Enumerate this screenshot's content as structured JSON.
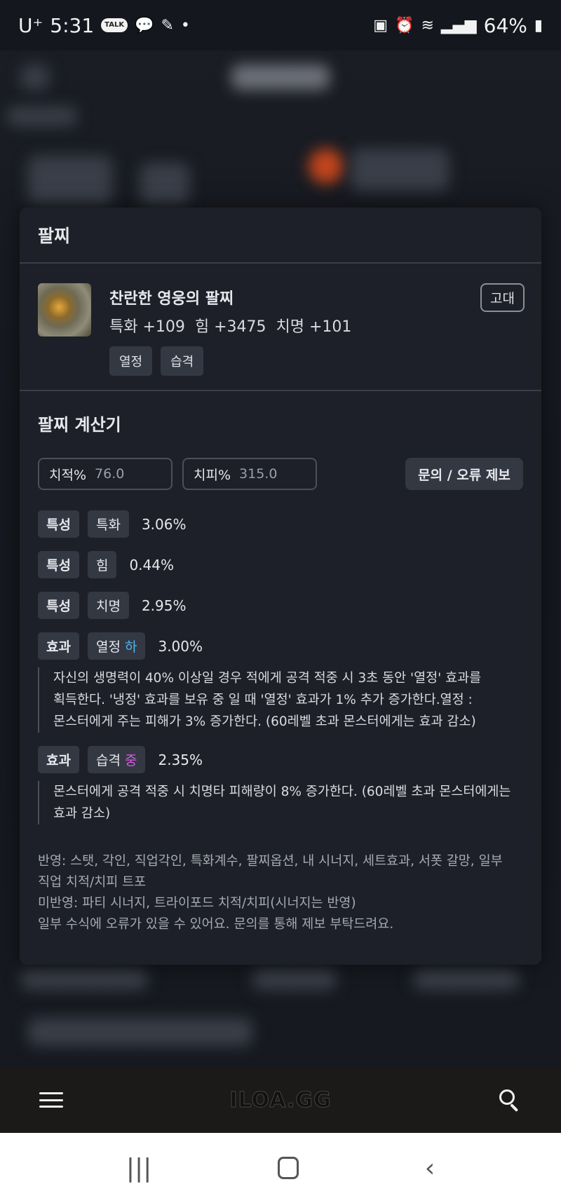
{
  "status_bar": {
    "carrier": "U⁺",
    "time": "5:31",
    "battery": "64%"
  },
  "modal": {
    "header": "팔찌",
    "item": {
      "name": "찬란한 영웅의 팔찌",
      "stats": "특화 +109  힘 +3475  치명 +101",
      "tags": [
        "열정",
        "습격"
      ],
      "grade": "고대"
    },
    "calculator": {
      "title": "팔찌 계산기",
      "crit_rate": {
        "label": "치적%",
        "value": "76.0"
      },
      "crit_dmg": {
        "label": "치피%",
        "value": "315.0"
      },
      "report_button": "문의 / 오류 제보",
      "rows": [
        {
          "kind": "특성",
          "name": "특화",
          "value": "3.06%"
        },
        {
          "kind": "특성",
          "name": "힘",
          "value": "0.44%"
        },
        {
          "kind": "특성",
          "name": "치명",
          "value": "2.95%"
        }
      ],
      "effects": [
        {
          "kind": "효과",
          "name": "열정",
          "level": "하",
          "value": "3.00%",
          "desc": [
            "자신의 생명력이 40% 이상일 경우 적에게 공격 적중 시 3초 동안 '열정' 효과를",
            "획득한다. '냉정' 효과를 보유 중 일 때 '열정' 효과가 1% 추가 증가한다.열정 :",
            "몬스터에게 주는 피해가 3% 증가한다. (60레벨 초과 몬스터에게는 효과 감소)"
          ]
        },
        {
          "kind": "효과",
          "name": "습격",
          "level": "중",
          "value": "2.35%",
          "desc": [
            "몬스터에게 공격 적중 시 치명타 피해량이 8% 증가한다. (60레벨 초과 몬스터에게는",
            "효과 감소)"
          ]
        }
      ],
      "notes": [
        "반영: 스탯, 각인, 직업각인, 특화계수, 팔찌옵션, 내 시너지, 세트효과, 서폿 갈망, 일부",
        "직업 치적/치피 트포",
        "미반영: 파티 시너지, 트라이포드 치적/치피(시너지는 반영)",
        "일부 수식에 오류가 있을 수 있어요. 문의를 통해 제보 부탁드려요."
      ]
    }
  },
  "bottom_bar": {
    "brand": "ILOA.GG"
  }
}
